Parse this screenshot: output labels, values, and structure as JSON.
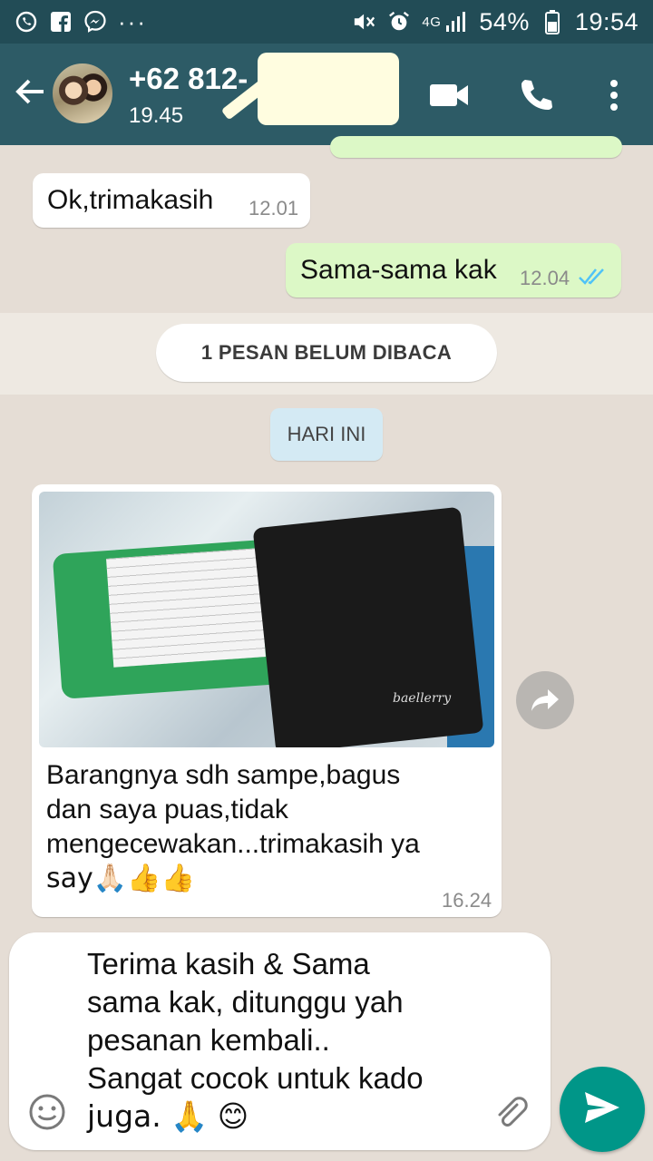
{
  "status_bar": {
    "battery": "54%",
    "time": "19:54",
    "network": "4G",
    "overflow": "···"
  },
  "header": {
    "contact_name": "+62 812-",
    "subtitle": "19.45"
  },
  "messages": [
    {
      "id": "m1",
      "direction": "incoming",
      "text": "Ok,trimakasih",
      "time": "12.01"
    },
    {
      "id": "m2",
      "direction": "outgoing",
      "text": "Sama-sama kak",
      "time": "12.04",
      "status": "read"
    }
  ],
  "unread_banner": "1 PESAN BELUM DIBACA",
  "day_divider": "HARI INI",
  "photo_message": {
    "caption_lines": [
      "Barangnya sdh sampe,bagus",
      "dan saya puas,tidak",
      "mengecewakan...trimakasih ya",
      "say🙏🏻👍👍"
    ],
    "time": "16.24",
    "wallet_brand": "baellerry"
  },
  "composer": {
    "text_lines": [
      "Terima kasih & Sama",
      "sama kak, ditunggu yah",
      "pesanan kembali..",
      "Sangat cocok untuk kado",
      "juga. 🙏 😊"
    ]
  },
  "colors": {
    "status_bar_bg": "#224c56",
    "app_bar_bg": "#2d5b66",
    "outgoing_bubble": "#dcf8c6",
    "incoming_bubble": "#ffffff",
    "send_button": "#009688",
    "read_ticks": "#4fc3f7"
  },
  "icons": [
    "whatsapp-icon",
    "facebook-icon",
    "messenger-icon",
    "mute-icon",
    "alarm-icon",
    "signal-icon",
    "battery-icon",
    "back-arrow-icon",
    "video-call-icon",
    "phone-icon",
    "more-vert-icon",
    "forward-icon",
    "emoji-icon",
    "attach-icon",
    "send-icon",
    "double-check-icon"
  ]
}
